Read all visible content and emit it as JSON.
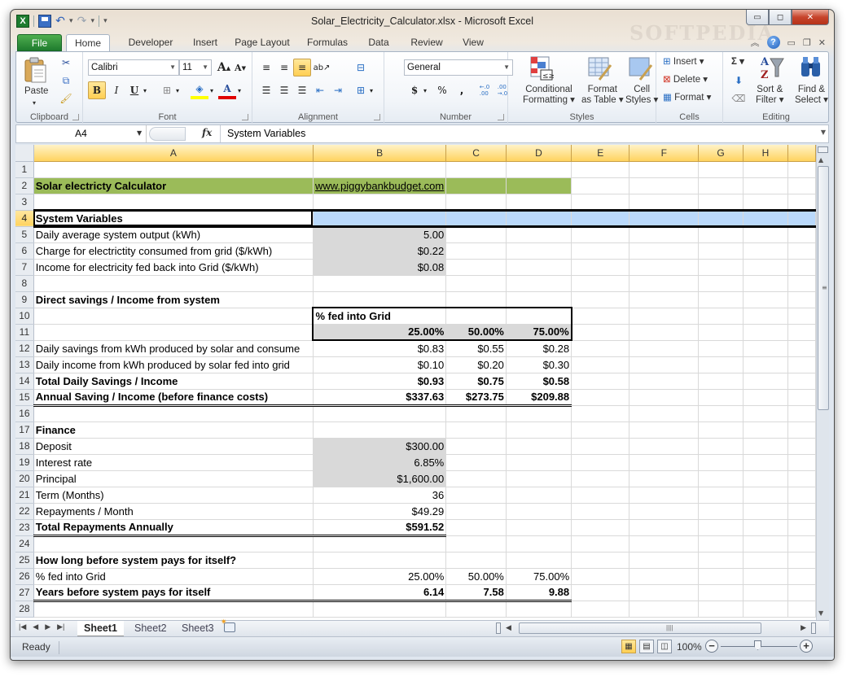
{
  "window": {
    "title": "Solar_Electricity_Calculator.xlsx  -  Microsoft Excel",
    "controls": {
      "minimize": "▭",
      "maximize": "◻",
      "close": "✕"
    }
  },
  "qat": {
    "app_icon": "X",
    "save": "save-icon",
    "undo": "↶",
    "redo": "↷",
    "customize": "▾"
  },
  "tabs": [
    {
      "label": "File"
    },
    {
      "label": "Home"
    },
    {
      "label": "Developer"
    },
    {
      "label": "Insert"
    },
    {
      "label": "Page Layout"
    },
    {
      "label": "Formulas"
    },
    {
      "label": "Data"
    },
    {
      "label": "Review"
    },
    {
      "label": "View"
    }
  ],
  "ribbon": {
    "clipboard": {
      "label": "Clipboard",
      "paste": "Paste"
    },
    "font": {
      "label": "Font",
      "name": "Calibri",
      "size": "11",
      "bold": "B",
      "italic": "I",
      "underline": "U",
      "grow": "A",
      "shrink": "A",
      "font_color": "A"
    },
    "alignment": {
      "label": "Alignment"
    },
    "number": {
      "label": "Number",
      "format": "General",
      "currency": "$",
      "percent": "%",
      "comma": ",",
      "inc_decimal": "←.0 .00",
      "dec_decimal": ".00 →.0"
    },
    "styles": {
      "label": "Styles",
      "conditional": [
        "Conditional",
        "Formatting ▾"
      ],
      "format_table": [
        "Format",
        "as Table ▾"
      ],
      "cell_styles": [
        "Cell",
        "Styles ▾"
      ]
    },
    "cells": {
      "label": "Cells",
      "insert": "Insert ▾",
      "delete": "Delete ▾",
      "format": "Format ▾"
    },
    "editing": {
      "label": "Editing",
      "sum": "Σ ▾",
      "sort": [
        "Sort &",
        "Filter ▾"
      ],
      "find": [
        "Find &",
        "Select ▾"
      ]
    }
  },
  "formula_bar": {
    "name_box": "A4",
    "fx": "fx",
    "content": "System Variables"
  },
  "columns": [
    "A",
    "B",
    "C",
    "D",
    "E",
    "F",
    "G",
    "H"
  ],
  "rows": [
    {
      "n": "1",
      "a": "",
      "b": "",
      "c": "",
      "d": ""
    },
    {
      "n": "2",
      "a": "Solar electricty Calculator",
      "b": "www.piggybankbudget.com",
      "c": "",
      "d": ""
    },
    {
      "n": "3",
      "a": "",
      "b": "",
      "c": "",
      "d": ""
    },
    {
      "n": "4",
      "a": "System Variables",
      "b": "",
      "c": "",
      "d": ""
    },
    {
      "n": "5",
      "a": "Daily average system output (kWh)",
      "b": "5.00",
      "c": "",
      "d": ""
    },
    {
      "n": "6",
      "a": "Charge for electrictity consumed from grid ($/kWh)",
      "b": "$0.22",
      "c": "",
      "d": ""
    },
    {
      "n": "7",
      "a": "Income for electricity fed back into Grid ($/kWh)",
      "b": "$0.08",
      "c": "",
      "d": ""
    },
    {
      "n": "8",
      "a": "",
      "b": "",
      "c": "",
      "d": ""
    },
    {
      "n": "9",
      "a": "Direct savings / Income from system",
      "b": "",
      "c": "",
      "d": ""
    },
    {
      "n": "10",
      "a": "",
      "b": "% fed into Grid",
      "c": "",
      "d": ""
    },
    {
      "n": "11",
      "a": "",
      "b": "25.00%",
      "c": "50.00%",
      "d": "75.00%"
    },
    {
      "n": "12",
      "a": "Daily savings from kWh produced by solar and consume",
      "b": "$0.83",
      "c": "$0.55",
      "d": "$0.28"
    },
    {
      "n": "13",
      "a": "Daily income from kWh produced by solar fed into grid",
      "b": "$0.10",
      "c": "$0.20",
      "d": "$0.30"
    },
    {
      "n": "14",
      "a": "Total Daily Savings / Income",
      "b": "$0.93",
      "c": "$0.75",
      "d": "$0.58"
    },
    {
      "n": "15",
      "a": "Annual Saving / Income (before finance costs)",
      "b": "$337.63",
      "c": "$273.75",
      "d": "$209.88"
    },
    {
      "n": "16",
      "a": "",
      "b": "",
      "c": "",
      "d": ""
    },
    {
      "n": "17",
      "a": "Finance",
      "b": "",
      "c": "",
      "d": ""
    },
    {
      "n": "18",
      "a": "Deposit",
      "b": "$300.00",
      "c": "",
      "d": ""
    },
    {
      "n": "19",
      "a": "Interest rate",
      "b": "6.85%",
      "c": "",
      "d": ""
    },
    {
      "n": "20",
      "a": "Principal",
      "b": "$1,600.00",
      "c": "",
      "d": ""
    },
    {
      "n": "21",
      "a": "Term (Months)",
      "b": "36",
      "c": "",
      "d": ""
    },
    {
      "n": "22",
      "a": "Repayments / Month",
      "b": "$49.29",
      "c": "",
      "d": ""
    },
    {
      "n": "23",
      "a": "Total Repayments Annually",
      "b": "$591.52",
      "c": "",
      "d": ""
    },
    {
      "n": "24",
      "a": "",
      "b": "",
      "c": "",
      "d": ""
    },
    {
      "n": "25",
      "a": "How long before system pays for itself?",
      "b": "",
      "c": "",
      "d": ""
    },
    {
      "n": "26",
      "a": "% fed into Grid",
      "b": "25.00%",
      "c": "50.00%",
      "d": "75.00%"
    },
    {
      "n": "27",
      "a": "Years before system pays for itself",
      "b": "6.14",
      "c": "7.58",
      "d": "9.88"
    },
    {
      "n": "28",
      "a": "",
      "b": "",
      "c": "",
      "d": ""
    }
  ],
  "sheet_tabs": [
    {
      "label": "Sheet1"
    },
    {
      "label": "Sheet2"
    },
    {
      "label": "Sheet3"
    }
  ],
  "status": {
    "ready": "Ready",
    "zoom": "100%"
  },
  "colors": {
    "title_fill": "#9bbb59",
    "selected_row_fill": "#bad9fb",
    "input_fill": "#d9d9d9",
    "link": "#0000ff",
    "file_tab": "#2a8a3a"
  }
}
